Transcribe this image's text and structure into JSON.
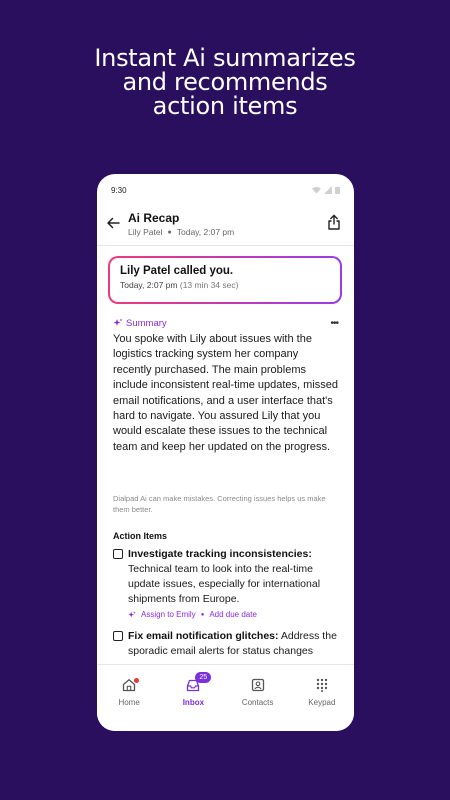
{
  "headline": {
    "lines": [
      "Instant Ai summarizes",
      "and recommends",
      "action items"
    ]
  },
  "status_bar": {
    "time": "9:30"
  },
  "header": {
    "title": "Ai Recap",
    "contact": "Lily Patel",
    "timestamp": "Today, 2:07 pm"
  },
  "call_card": {
    "title": "Lily Patel called you.",
    "time": "Today, 2:07 pm",
    "duration": "(13 min 34 sec)"
  },
  "summary": {
    "label": "Summary",
    "more": "•••",
    "body": "You spoke with Lily about issues with the logistics tracking system her company recently purchased. The main problems include inconsistent real-time updates, missed email notifications, and a user interface that's hard to navigate. You assured Lily that you would escalate these issues to the technical team and keep her updated on the progress.",
    "disclaimer": "Dialpad Ai can make mistakes. Correcting issues helps us make them better."
  },
  "action_items": {
    "heading": "Action Items",
    "items": [
      {
        "title": "Investigate tracking inconsistencies:",
        "description": "Technical team to look into the real-time update issues, especially for international shipments from Europe.",
        "assign": "Assign to Emily",
        "due": "Add due date",
        "checked": false
      },
      {
        "title": "Fix email notification glitches:",
        "description": "Address the sporadic email alerts for status changes",
        "checked": false
      }
    ]
  },
  "tabbar": {
    "tabs": [
      {
        "label": "Home",
        "icon": "home-icon"
      },
      {
        "label": "Inbox",
        "icon": "inbox-icon",
        "badge": "25",
        "active": true
      },
      {
        "label": "Contacts",
        "icon": "contacts-icon"
      },
      {
        "label": "Keypad",
        "icon": "keypad-icon"
      }
    ]
  },
  "colors": {
    "background": "#2a0f5e",
    "accent": "#7b2fdc",
    "gradient_start": "#ef3a7a",
    "gradient_end": "#9b3be6"
  }
}
